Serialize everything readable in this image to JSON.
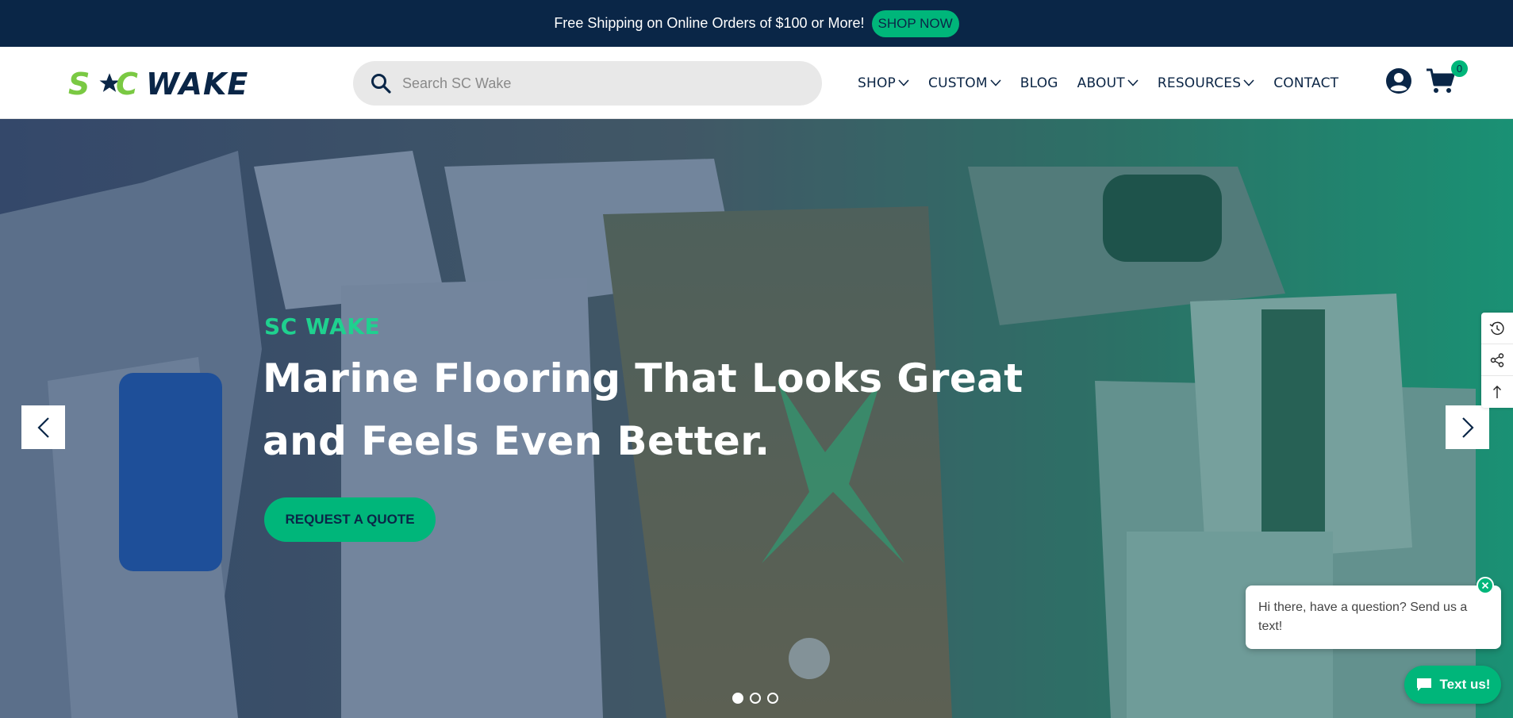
{
  "announcement": {
    "text": "Free Shipping on Online Orders of $100 or More!",
    "button": "SHOP NOW"
  },
  "brand": {
    "logo": "SCWAKE",
    "colors": {
      "navy": "#0a2647",
      "green": "#00b67a",
      "lime": "#7ac943"
    }
  },
  "search": {
    "placeholder": "Search SC Wake",
    "icon": "search-icon"
  },
  "nav": {
    "items": [
      {
        "label": "SHOP",
        "dropdown": true
      },
      {
        "label": "CUSTOM",
        "dropdown": true
      },
      {
        "label": "BLOG",
        "dropdown": false
      },
      {
        "label": "ABOUT",
        "dropdown": true
      },
      {
        "label": "RESOURCES",
        "dropdown": true
      },
      {
        "label": "CONTACT",
        "dropdown": false
      }
    ]
  },
  "header_icons": {
    "account": "account-icon",
    "cart": "cart-icon",
    "cart_count": "0"
  },
  "hero": {
    "eyebrow": "SC WAKE",
    "title_line1": "Marine Flooring That Looks Great",
    "title_line2": "and Feels Even Better.",
    "cta": "REQUEST A QUOTE",
    "slides_total": 3,
    "active_slide": 1
  },
  "side_tools": [
    "history-icon",
    "share-icon",
    "back-to-top-icon"
  ],
  "chat": {
    "message": "Hi there, have a question? Send us a text!",
    "button": "Text us!"
  }
}
